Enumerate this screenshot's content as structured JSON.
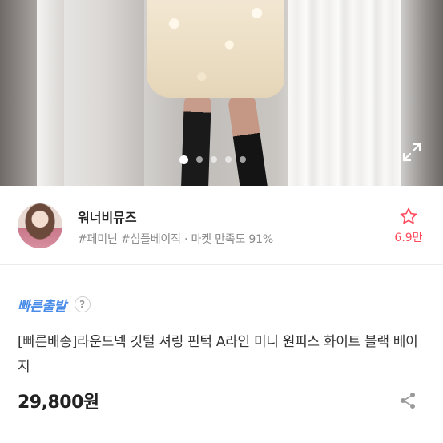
{
  "gallery": {
    "slides": 5,
    "active_index": 0
  },
  "seller": {
    "name": "워너비뮤즈",
    "tags": "#페미닌 #심플베이직 · 마켓 만족도 91%",
    "wish_count": "6.9만"
  },
  "product": {
    "badge": "빠른출발",
    "help": "?",
    "title": "[빠른배송]라운드넥 깃털 셔링 핀턱 A라인 미니 원피스 화이트 블랙 베이지",
    "price": "29,800원"
  },
  "colors": {
    "accent_blue": "#4a8de8",
    "wish_red": "#ff4b5c"
  },
  "icons": [
    "expand-icon",
    "star-icon",
    "help-icon",
    "share-icon"
  ]
}
